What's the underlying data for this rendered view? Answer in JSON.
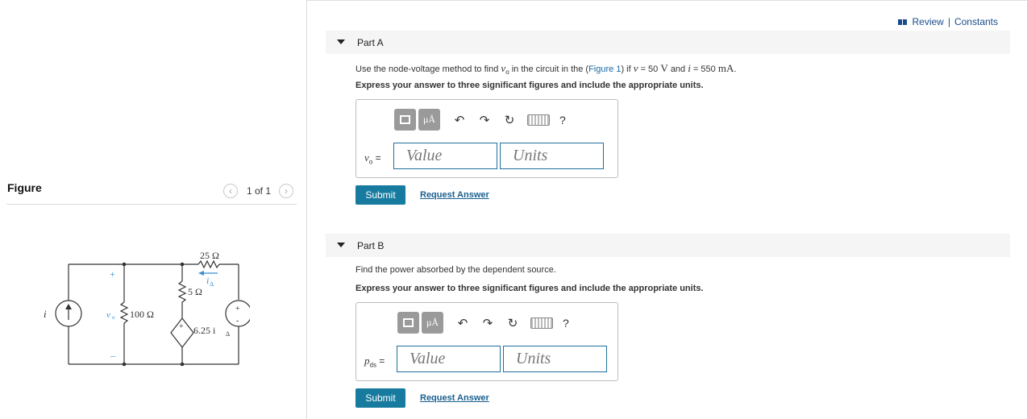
{
  "figure_panel": {
    "title": "Figure",
    "pager": "1 of 1",
    "circuit": {
      "r_top": "25 Ω",
      "r_mid": "5 Ω",
      "r_left": "100 Ω",
      "current_label": "i",
      "current_sub": "Δ",
      "dep_source": "6.25 i",
      "dep_sub": "Δ",
      "source_i": "i",
      "source_v": "v",
      "vo_label": "v",
      "vo_sub": "o",
      "plus": "+",
      "minus": "–",
      "minus_plain": "-"
    }
  },
  "header": {
    "review": "Review",
    "separator": "|",
    "constants": "Constants"
  },
  "part_a": {
    "label": "Part A",
    "prompt_before": "Use the node-voltage method to find",
    "prompt_var": "v",
    "prompt_var_sub": "o",
    "prompt_mid": "in the circuit in the (",
    "figure_link": "Figure 1",
    "prompt_after": ") if",
    "cond_v": "v",
    "cond_v_eq": "= 50",
    "cond_v_unit": "V",
    "cond_and": "and",
    "cond_i": "i",
    "cond_i_eq": "= 550",
    "cond_i_unit": "mA",
    "cond_end": ".",
    "instruction": "Express your answer to three significant figures and include the appropriate units.",
    "var_label": "v",
    "var_sub": "o",
    "equals": "=",
    "value_placeholder": "Value",
    "units_placeholder": "Units",
    "submit": "Submit",
    "request": "Request Answer"
  },
  "part_b": {
    "label": "Part B",
    "prompt": "Find the power absorbed by the dependent source.",
    "instruction": "Express your answer to three significant figures and include the appropriate units.",
    "var_label": "p",
    "var_sub": "ds",
    "equals": "=",
    "value_placeholder": "Value",
    "units_placeholder": "Units",
    "submit": "Submit",
    "request": "Request Answer"
  },
  "toolbar": {
    "units_btn": "μÅ",
    "help": "?",
    "icons": [
      "templates-icon",
      "units-icon",
      "undo-icon",
      "redo-icon",
      "reset-icon",
      "keyboard-icon",
      "help-icon"
    ]
  }
}
